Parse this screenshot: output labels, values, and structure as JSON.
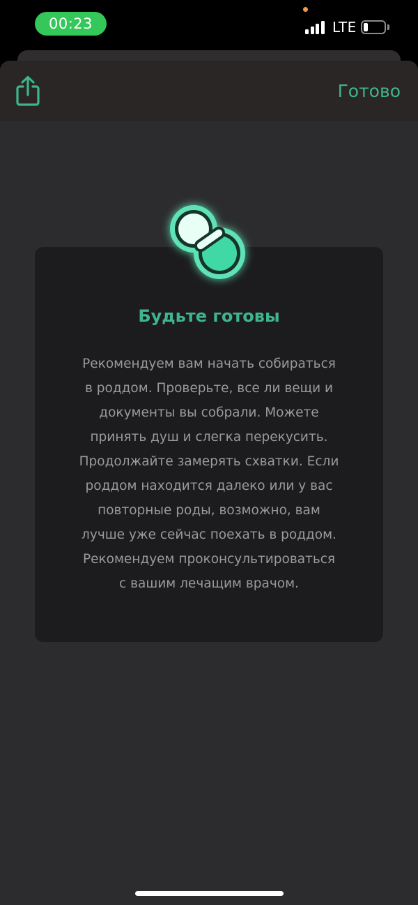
{
  "status_bar": {
    "time": "00:23",
    "network": "LTE",
    "time_pill_color": "#34c759",
    "privacy_dot_color": "#f2994a",
    "battery_level": 0.2,
    "signal_bars": 4
  },
  "nav": {
    "share_icon": "share-icon",
    "done_label": "Готово",
    "accent_color": "#3fb58c"
  },
  "card": {
    "icon": "pacifier-icon",
    "title": "Будьте готовы",
    "body": "Рекомендуем вам начать собираться\nв роддом. Проверьте, все ли вещи и\nдокументы вы собрали. Можете\nпринять душ и слегка перекусить.\nПродолжайте замерять схватки. Если\nроддом находится далеко или у вас\nповторные роды, возможно, вам\nлучше уже сейчас поехать в роддом.\nРекомендуем проконсультироваться\nс вашим лечащим врачом."
  }
}
